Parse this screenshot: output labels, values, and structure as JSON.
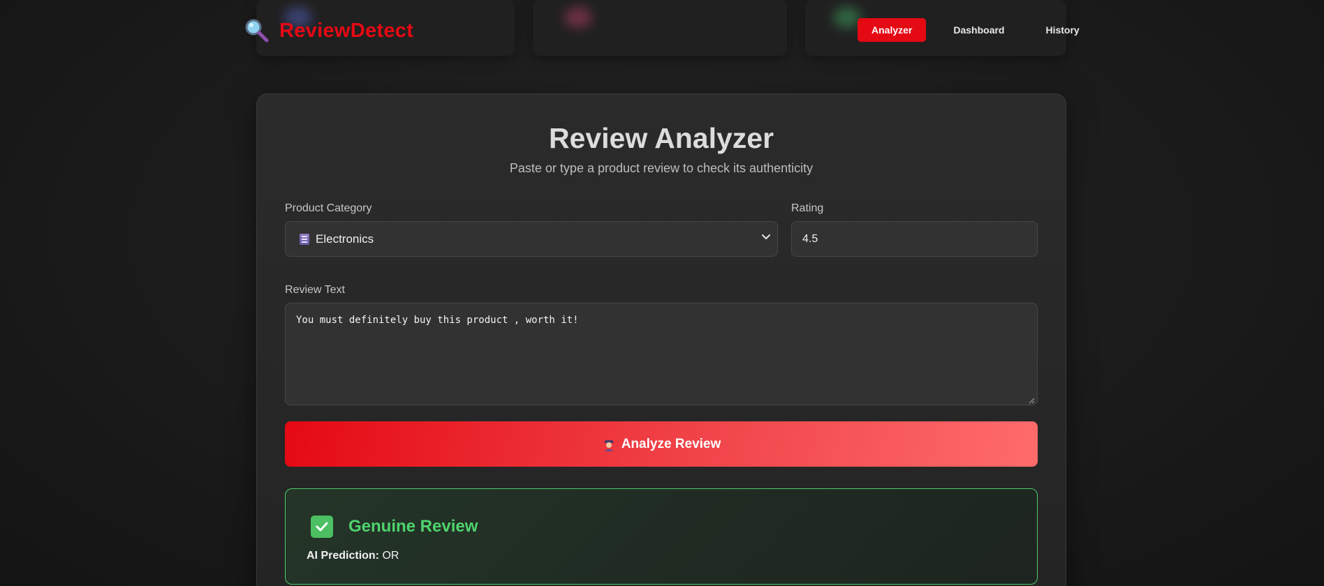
{
  "brand": {
    "title": "ReviewDetect",
    "icon": "magnifier-icon",
    "color": "#e50914"
  },
  "nav": {
    "items": [
      {
        "label": "Analyzer",
        "active": true
      },
      {
        "label": "Dashboard",
        "active": false
      },
      {
        "label": "History",
        "active": false
      }
    ]
  },
  "analyzer": {
    "title": "Review Analyzer",
    "subtitle": "Paste or type a product review to check its authenticity",
    "category": {
      "label": "Product Category",
      "value": "Electronics",
      "icon": "building-icon"
    },
    "rating": {
      "label": "Rating",
      "value": "4.5"
    },
    "review": {
      "label": "Review Text",
      "value": "You must definitely buy this product , worth it!"
    },
    "analyze_button": {
      "label": "Analyze Review",
      "icon": "detective-icon"
    }
  },
  "result": {
    "verdict": "Genuine Review",
    "prediction_label": "AI Prediction:",
    "prediction_value": "OR",
    "accent": "#4fca6b",
    "icon": "check-icon"
  }
}
